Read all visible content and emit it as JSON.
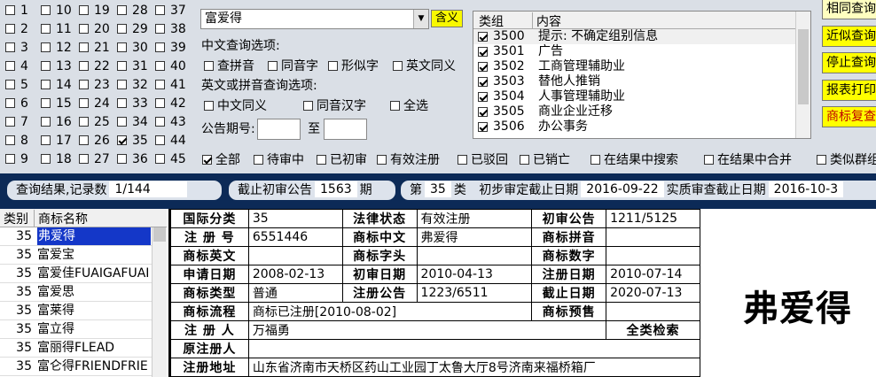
{
  "category_grid": {
    "columns": [
      [
        {
          "num": "1",
          "checked": false
        },
        {
          "num": "2",
          "checked": false
        },
        {
          "num": "3",
          "checked": false
        },
        {
          "num": "4",
          "checked": false
        },
        {
          "num": "5",
          "checked": false
        },
        {
          "num": "6",
          "checked": false
        },
        {
          "num": "7",
          "checked": false
        },
        {
          "num": "8",
          "checked": false
        },
        {
          "num": "9",
          "checked": false
        }
      ],
      [
        {
          "num": "10",
          "checked": false
        },
        {
          "num": "11",
          "checked": false
        },
        {
          "num": "12",
          "checked": false
        },
        {
          "num": "13",
          "checked": false
        },
        {
          "num": "14",
          "checked": false
        },
        {
          "num": "15",
          "checked": false
        },
        {
          "num": "16",
          "checked": false
        },
        {
          "num": "17",
          "checked": false
        },
        {
          "num": "18",
          "checked": false
        }
      ],
      [
        {
          "num": "19",
          "checked": false
        },
        {
          "num": "20",
          "checked": false
        },
        {
          "num": "21",
          "checked": false
        },
        {
          "num": "22",
          "checked": false
        },
        {
          "num": "23",
          "checked": false
        },
        {
          "num": "24",
          "checked": false
        },
        {
          "num": "25",
          "checked": false
        },
        {
          "num": "26",
          "checked": false
        },
        {
          "num": "27",
          "checked": false
        }
      ],
      [
        {
          "num": "28",
          "checked": false
        },
        {
          "num": "29",
          "checked": false
        },
        {
          "num": "30",
          "checked": false
        },
        {
          "num": "31",
          "checked": false
        },
        {
          "num": "32",
          "checked": false
        },
        {
          "num": "33",
          "checked": false
        },
        {
          "num": "34",
          "checked": false
        },
        {
          "num": "35",
          "checked": true
        },
        {
          "num": "36",
          "checked": false
        }
      ],
      [
        {
          "num": "37",
          "checked": false
        },
        {
          "num": "38",
          "checked": false
        },
        {
          "num": "39",
          "checked": false
        },
        {
          "num": "40",
          "checked": false
        },
        {
          "num": "41",
          "checked": false
        },
        {
          "num": "42",
          "checked": false
        },
        {
          "num": "43",
          "checked": false
        },
        {
          "num": "44",
          "checked": false
        },
        {
          "num": "45",
          "checked": false
        }
      ]
    ]
  },
  "search": {
    "value": "富爱得",
    "yiyi_label": "含义"
  },
  "chinese_options": {
    "title": "中文查询选项:",
    "items": [
      {
        "label": "查拼音",
        "checked": false
      },
      {
        "label": "同音字",
        "checked": false
      },
      {
        "label": "形似字",
        "checked": false
      },
      {
        "label": "英文同义",
        "checked": false
      }
    ]
  },
  "english_options": {
    "title": "英文或拼音查询选项:",
    "items": [
      {
        "label": "中文同义",
        "checked": false
      },
      {
        "label": "同音汉字",
        "checked": false
      },
      {
        "label": "全选",
        "checked": false
      }
    ]
  },
  "period": {
    "label": "公告期号:",
    "to_label": "至",
    "from_value": "",
    "to_value": ""
  },
  "groups": {
    "col_group": "类组",
    "col_content": "内容",
    "rows": [
      {
        "code": "3500",
        "text": "提示: 不确定组别信息",
        "checked": true
      },
      {
        "code": "3501",
        "text": "广告",
        "checked": true
      },
      {
        "code": "3502",
        "text": "工商管理辅助业",
        "checked": true
      },
      {
        "code": "3503",
        "text": "替他人推销",
        "checked": true
      },
      {
        "code": "3504",
        "text": "人事管理辅助业",
        "checked": true
      },
      {
        "code": "3505",
        "text": "商业企业迁移",
        "checked": true
      },
      {
        "code": "3506",
        "text": "办公事务",
        "checked": true
      }
    ]
  },
  "right_buttons": [
    {
      "label": "相同查询",
      "bg": "#ffffc0"
    },
    {
      "label": "近似查询",
      "bg": "#ffff00"
    },
    {
      "label": "停止查询",
      "bg": "#ffff00"
    },
    {
      "label": "报表打印",
      "bg": "#ffff00"
    },
    {
      "label": "商标复查",
      "bg": "#ffff00",
      "color": "#c00000"
    }
  ],
  "filters": [
    {
      "label": "全部",
      "checked": true
    },
    {
      "label": "待审中",
      "checked": false
    },
    {
      "label": "已初审",
      "checked": false
    },
    {
      "label": "有效注册",
      "checked": false
    },
    {
      "label": "已驳回",
      "checked": false
    },
    {
      "label": "已销亡",
      "checked": false
    },
    {
      "label": "在结果中搜索",
      "checked": false
    },
    {
      "label": "在结果中合并",
      "checked": false
    },
    {
      "label": "类似群组",
      "checked": false
    }
  ],
  "status_bar": {
    "result_label": "查询结果,记录数",
    "result_value": "1/144",
    "cutoff_label": "截止初审公告",
    "cutoff_value": "1563",
    "cutoff_unit": "期",
    "class_prefix": "第",
    "class_value": "35",
    "class_suffix": "类",
    "initial_label": "初步审定截止日期",
    "initial_value": "2016-09-22",
    "actual_label": "实质审查截止日期",
    "actual_value": "2016-10-3"
  },
  "result_list": {
    "col_class": "类别",
    "col_name": "商标名称",
    "rows": [
      {
        "cls": "35",
        "name": "弗爱得",
        "selected": true
      },
      {
        "cls": "35",
        "name": "富爱宝",
        "selected": false
      },
      {
        "cls": "35",
        "name": "富爱佳FUAIGAFUAI",
        "selected": false
      },
      {
        "cls": "35",
        "name": "富爱思",
        "selected": false
      },
      {
        "cls": "35",
        "name": "富莱得",
        "selected": false
      },
      {
        "cls": "35",
        "name": "富立得",
        "selected": false
      },
      {
        "cls": "35",
        "name": "富丽得FLEAD",
        "selected": false
      },
      {
        "cls": "35",
        "name": "富仑得FRIENDFRIE",
        "selected": false
      }
    ]
  },
  "detail": {
    "intl_class_k": "国际分类",
    "intl_class": "35",
    "legal_status_k": "法律状态",
    "legal_status": "有效注册",
    "pub_k": "初审公告",
    "pub": "1211/5125",
    "reg_no_k": "注 册 号",
    "reg_no": "6551446",
    "cn_k": "商标中文",
    "cn": "弗爱得",
    "pinyin_k": "商标拼音",
    "pinyin": "",
    "en_k": "商标英文",
    "en": "",
    "initial_k": "商标字头",
    "initial": "",
    "digit_k": "商标数字",
    "digit": "",
    "apply_date_k": "申请日期",
    "apply_date": "2008-02-13",
    "first_date_k": "初审日期",
    "first_date": "2010-04-13",
    "reg_date_k": "注册日期",
    "reg_date": "2010-07-14",
    "type_k": "商标类型",
    "type": "普通",
    "reg_pub_k": "注册公告",
    "reg_pub": "1223/6511",
    "expire_k": "截止日期",
    "expire": "2020-07-13",
    "flow_k": "商标流程",
    "flow": "商标已注册[2010-08-02]",
    "preview_k": "商标预售",
    "preview": "",
    "registrant_k": "注 册 人",
    "registrant": "万福勇",
    "all_search": "全类检索",
    "orig_k": "原注册人",
    "orig": "",
    "addr_k": "注册地址",
    "addr": "山东省济南市天桥区药山工业园丁太鲁大厅8号济南来福桥箱厂"
  },
  "preview_text": "弗爱得"
}
